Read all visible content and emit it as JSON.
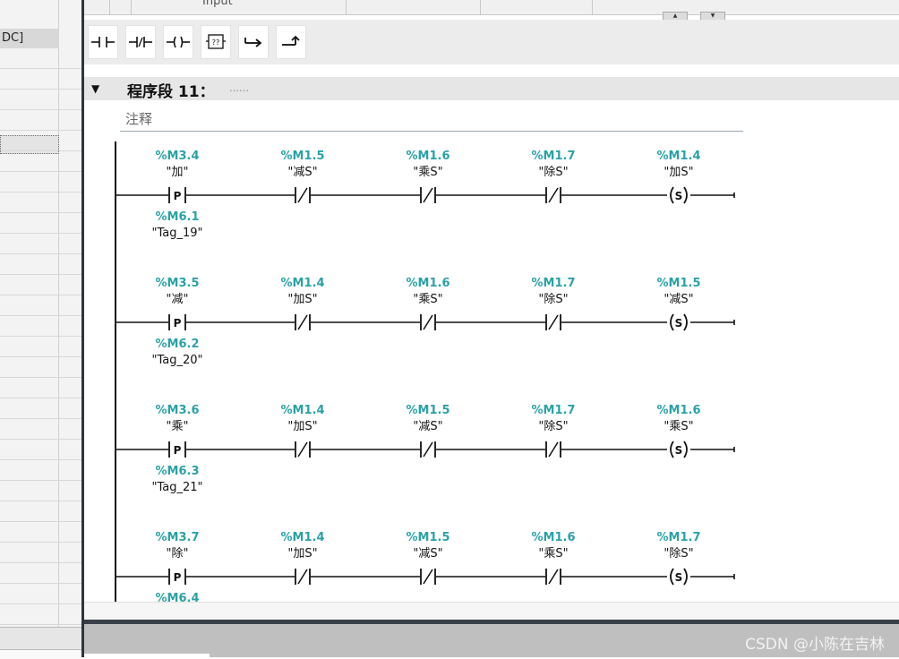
{
  "left_panel": {
    "visible_label": "DC]"
  },
  "top_strip": {
    "input_text": "Input",
    "spin_up": "▲",
    "spin_down": "▼"
  },
  "toolbar": {
    "buttons": [
      {
        "name": "no-contact",
        "icon": "normally-open-contact-icon"
      },
      {
        "name": "nc-contact",
        "icon": "normally-closed-contact-icon"
      },
      {
        "name": "coil",
        "icon": "coil-icon"
      },
      {
        "name": "empty-box",
        "icon": "empty-box-icon",
        "label": "??"
      },
      {
        "name": "open-branch",
        "icon": "open-branch-icon"
      },
      {
        "name": "close-branch",
        "icon": "close-branch-icon"
      }
    ]
  },
  "network": {
    "toggle": "▼",
    "title": "程序段 11：",
    "title_dots": "……",
    "comment": "注释"
  },
  "symbols": {
    "p": "P",
    "s": "S"
  },
  "rungs": [
    {
      "p_contact": {
        "addr": "%M3.4",
        "name": "\"加\"",
        "edge_addr": "%M6.1",
        "edge_name": "\"Tag_19\""
      },
      "nc": [
        {
          "addr": "%M1.5",
          "name": "\"减S\""
        },
        {
          "addr": "%M1.6",
          "name": "\"乘S\""
        },
        {
          "addr": "%M1.7",
          "name": "\"除S\""
        }
      ],
      "coil": {
        "addr": "%M1.4",
        "name": "\"加S\""
      }
    },
    {
      "p_contact": {
        "addr": "%M3.5",
        "name": "\"减\"",
        "edge_addr": "%M6.2",
        "edge_name": "\"Tag_20\""
      },
      "nc": [
        {
          "addr": "%M1.4",
          "name": "\"加S\""
        },
        {
          "addr": "%M1.6",
          "name": "\"乘S\""
        },
        {
          "addr": "%M1.7",
          "name": "\"除S\""
        }
      ],
      "coil": {
        "addr": "%M1.5",
        "name": "\"减S\""
      }
    },
    {
      "p_contact": {
        "addr": "%M3.6",
        "name": "\"乘\"",
        "edge_addr": "%M6.3",
        "edge_name": "\"Tag_21\""
      },
      "nc": [
        {
          "addr": "%M1.4",
          "name": "\"加S\""
        },
        {
          "addr": "%M1.5",
          "name": "\"减S\""
        },
        {
          "addr": "%M1.7",
          "name": "\"除S\""
        }
      ],
      "coil": {
        "addr": "%M1.6",
        "name": "\"乘S\""
      }
    },
    {
      "p_contact": {
        "addr": "%M3.7",
        "name": "\"除\"",
        "edge_addr": "%M6.4",
        "edge_name": ""
      },
      "nc": [
        {
          "addr": "%M1.4",
          "name": "\"加S\""
        },
        {
          "addr": "%M1.5",
          "name": "\"减S\""
        },
        {
          "addr": "%M1.6",
          "name": "\"乘S\""
        }
      ],
      "coil": {
        "addr": "%M1.7",
        "name": "\"除S\""
      }
    }
  ],
  "status_bar": {
    "watermark": "CSDN @小陈在吉林"
  }
}
